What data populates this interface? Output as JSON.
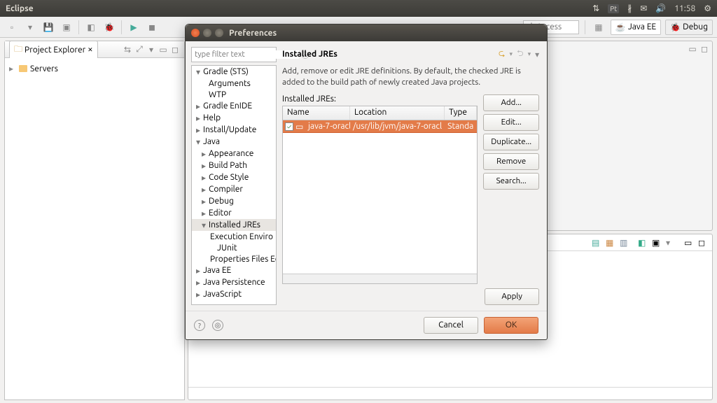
{
  "menubar": {
    "title": "Eclipse",
    "time": "11:58",
    "lang": "Pt"
  },
  "toolbar": {
    "quick_access_placeholder": "ck Access"
  },
  "perspectives": {
    "javaee": "Java EE",
    "debug": "Debug"
  },
  "explorer": {
    "tab": "Project Explorer",
    "items": [
      "Servers"
    ]
  },
  "dialog": {
    "title": "Preferences",
    "filter_placeholder": "type filter text",
    "tree": [
      {
        "label": "Gradle (STS)",
        "lvl": 0,
        "exp": "▾"
      },
      {
        "label": "Arguments",
        "lvl": 1
      },
      {
        "label": "WTP",
        "lvl": 1
      },
      {
        "label": "Gradle EnIDE",
        "lvl": 0,
        "exp": "▸"
      },
      {
        "label": "Help",
        "lvl": 0,
        "exp": "▸"
      },
      {
        "label": "Install/Update",
        "lvl": 0,
        "exp": "▸"
      },
      {
        "label": "Java",
        "lvl": 0,
        "exp": "▾"
      },
      {
        "label": "Appearance",
        "lvl": 1,
        "exp": "▸"
      },
      {
        "label": "Build Path",
        "lvl": 1,
        "exp": "▸"
      },
      {
        "label": "Code Style",
        "lvl": 1,
        "exp": "▸"
      },
      {
        "label": "Compiler",
        "lvl": 1,
        "exp": "▸"
      },
      {
        "label": "Debug",
        "lvl": 1,
        "exp": "▸"
      },
      {
        "label": "Editor",
        "lvl": 1,
        "exp": "▸"
      },
      {
        "label": "Installed JREs",
        "lvl": 1,
        "exp": "▾",
        "sel": true
      },
      {
        "label": "Execution Enviro",
        "lvl": 2
      },
      {
        "label": "JUnit",
        "lvl": 2
      },
      {
        "label": "Properties Files Ed",
        "lvl": 2
      },
      {
        "label": "Java EE",
        "lvl": 0,
        "exp": "▸"
      },
      {
        "label": "Java Persistence",
        "lvl": 0,
        "exp": "▸"
      },
      {
        "label": "JavaScript",
        "lvl": 0,
        "exp": "▸"
      }
    ],
    "section": {
      "title": "Installed JREs",
      "desc": "Add, remove or edit JRE definitions. By default, the checked JRE is added to the build path of newly created Java projects.",
      "list_label": "Installed JREs:",
      "columns": {
        "name": "Name",
        "location": "Location",
        "type": "Type"
      },
      "row": {
        "name": "java-7-oracl",
        "location": "/usr/lib/jvm/java-7-oracl",
        "type": "Standa"
      },
      "buttons": {
        "add": "Add...",
        "edit": "Edit...",
        "duplicate": "Duplicate...",
        "remove": "Remove",
        "search": "Search..."
      },
      "apply": "Apply"
    },
    "footer": {
      "cancel": "Cancel",
      "ok": "OK"
    }
  }
}
